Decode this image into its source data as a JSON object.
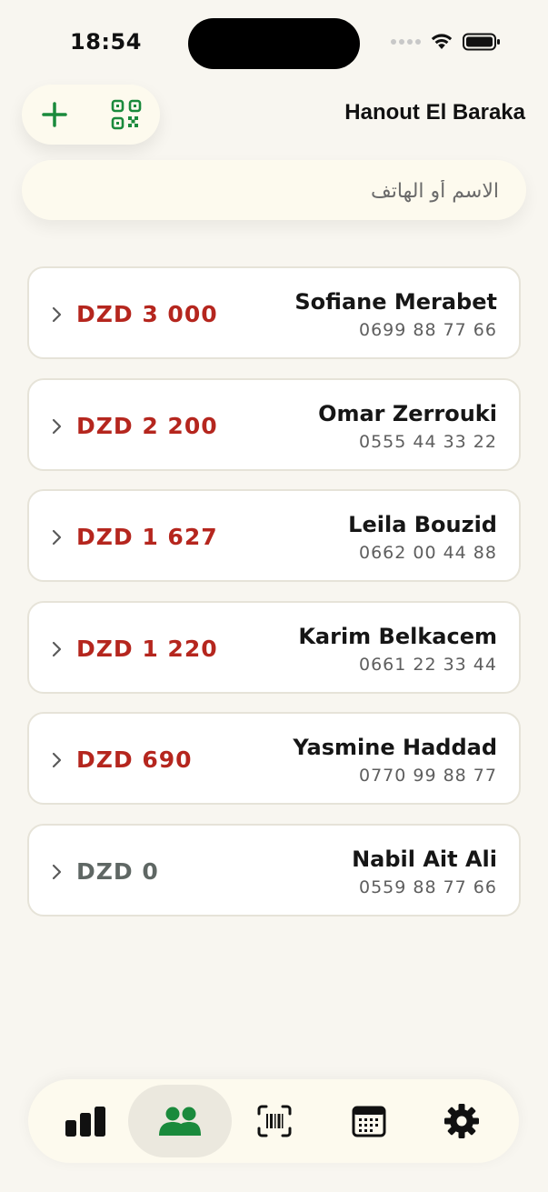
{
  "status_bar": {
    "time": "18:54"
  },
  "header": {
    "title": "Hanout El Baraka",
    "add_icon": "plus-icon",
    "qr_icon": "qr-code-icon"
  },
  "search": {
    "placeholder": "الاسم أو الهاتف",
    "value": ""
  },
  "colors": {
    "accent_green": "#1a8a3c",
    "debt_red": "#b5261e",
    "zero_gray": "#5f6764",
    "background": "#f8f6f0"
  },
  "customers": [
    {
      "name": "Sofiane Merabet",
      "phone": "0699 88 77 66",
      "amount": "DZD 3 000"
    },
    {
      "name": "Omar Zerrouki",
      "phone": "0555 44 33 22",
      "amount": "DZD 2 200"
    },
    {
      "name": "Leila Bouzid",
      "phone": "0662 00 44 88",
      "amount": "DZD 1 627"
    },
    {
      "name": "Karim Belkacem",
      "phone": "0661 22 33 44",
      "amount": "DZD 1 220"
    },
    {
      "name": "Yasmine Haddad",
      "phone": "0770 99 88 77",
      "amount": "DZD 690"
    },
    {
      "name": "Nabil Ait Ali",
      "phone": "0559 88 77 66",
      "amount": "DZD 0"
    }
  ],
  "tab_bar": {
    "tabs": [
      {
        "icon": "bar-chart-icon",
        "active": false
      },
      {
        "icon": "customers-icon",
        "active": true
      },
      {
        "icon": "barcode-scan-icon",
        "active": false
      },
      {
        "icon": "calendar-icon",
        "active": false
      },
      {
        "icon": "settings-gear-icon",
        "active": false
      }
    ]
  }
}
